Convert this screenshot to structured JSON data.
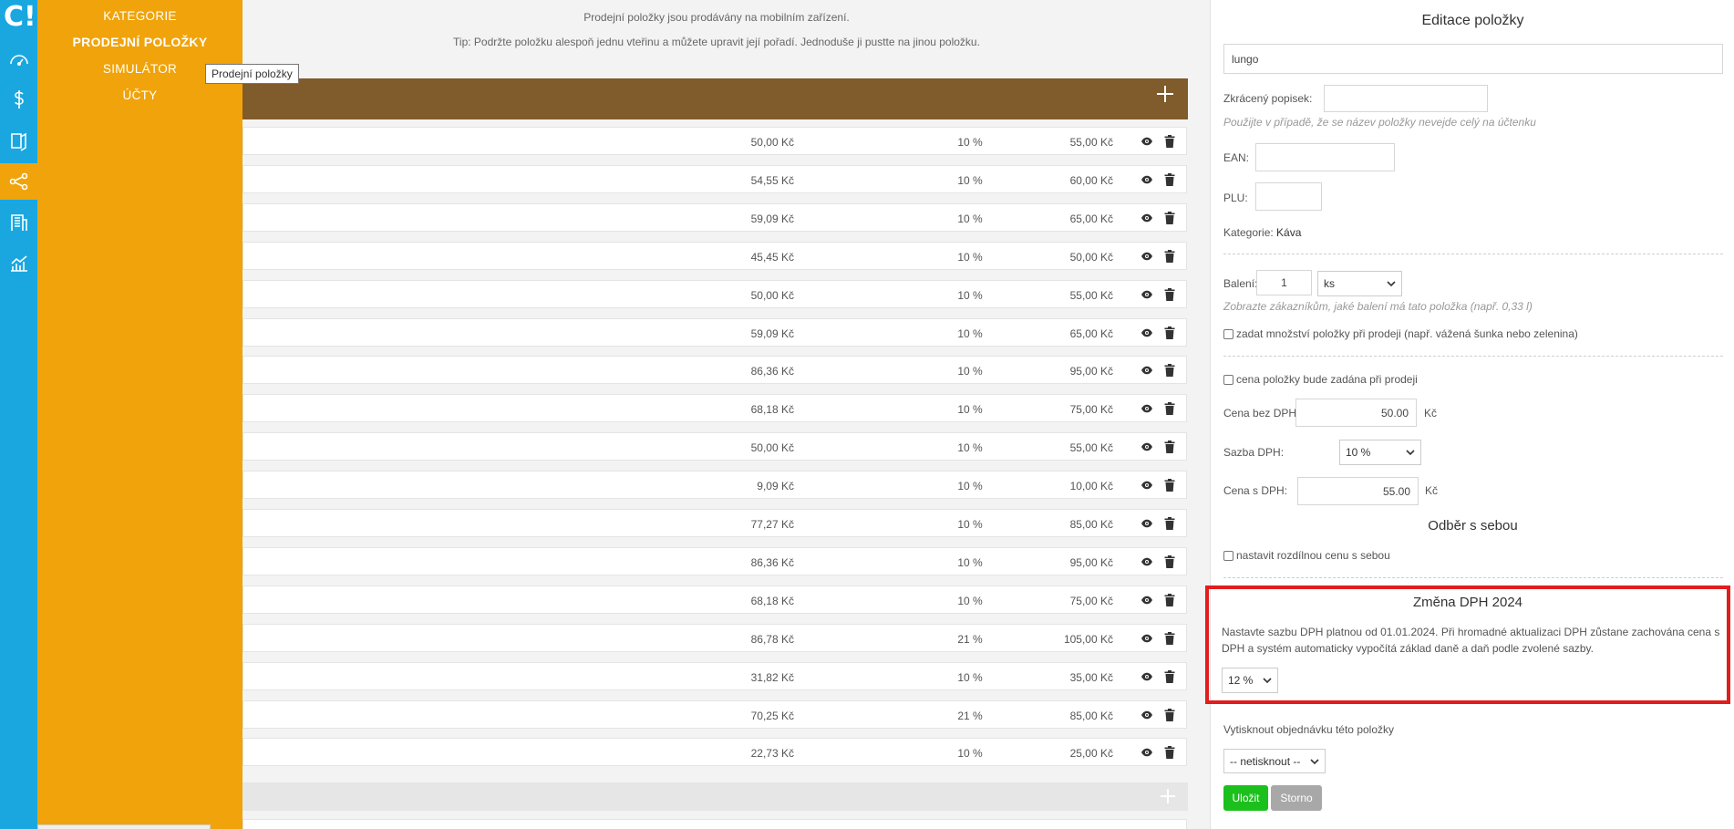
{
  "rail": {
    "logo": "C!",
    "icons": [
      "dashboard-icon",
      "dollar-icon",
      "documents-icon",
      "share-icon",
      "building-icon",
      "chart-icon"
    ]
  },
  "submenu": {
    "items": [
      "KATEGORIE",
      "PRODEJNÍ POLOŽKY",
      "SIMULÁTOR",
      "ÚČTY"
    ],
    "active_index": 1
  },
  "tooltip": "Prodejní položky",
  "info": {
    "line1": "Prodejní položky jsou prodávány na mobilním zařízení.",
    "line2": "Tip: Podržte položku alespoň jednu vteřinu a můžete upravit její pořadí. Jednoduše ji pustte na jinou položku."
  },
  "rows": [
    {
      "net": "50,00 Kč",
      "vat": "10 %",
      "gross": "55,00 Kč"
    },
    {
      "net": "54,55 Kč",
      "vat": "10 %",
      "gross": "60,00 Kč"
    },
    {
      "net": "59,09 Kč",
      "vat": "10 %",
      "gross": "65,00 Kč"
    },
    {
      "net": "45,45 Kč",
      "vat": "10 %",
      "gross": "50,00 Kč"
    },
    {
      "net": "50,00 Kč",
      "vat": "10 %",
      "gross": "55,00 Kč"
    },
    {
      "net": "59,09 Kč",
      "vat": "10 %",
      "gross": "65,00 Kč"
    },
    {
      "net": "86,36 Kč",
      "vat": "10 %",
      "gross": "95,00 Kč"
    },
    {
      "net": "68,18 Kč",
      "vat": "10 %",
      "gross": "75,00 Kč"
    },
    {
      "net": "50,00 Kč",
      "vat": "10 %",
      "gross": "55,00 Kč"
    },
    {
      "net": "9,09 Kč",
      "vat": "10 %",
      "gross": "10,00 Kč"
    },
    {
      "net": "77,27 Kč",
      "vat": "10 %",
      "gross": "85,00 Kč"
    },
    {
      "net": "86,36 Kč",
      "vat": "10 %",
      "gross": "95,00 Kč"
    },
    {
      "net": "68,18 Kč",
      "vat": "10 %",
      "gross": "75,00 Kč"
    },
    {
      "net": "86,78 Kč",
      "vat": "21 %",
      "gross": "105,00 Kč"
    },
    {
      "net": "31,82 Kč",
      "vat": "10 %",
      "gross": "35,00 Kč"
    },
    {
      "net": "70,25 Kč",
      "vat": "21 %",
      "gross": "85,00 Kč"
    },
    {
      "net": "22,73 Kč",
      "vat": "10 %",
      "gross": "25,00 Kč"
    }
  ],
  "panel": {
    "title": "Editace položky",
    "name_value": "lungo",
    "short_label": "Zkrácený popisek:",
    "short_value": "",
    "short_hint": "Použijte v případě, že se název položky nevejde celý na účtenku",
    "ean_label": "EAN:",
    "plu_label": "PLU:",
    "category_label": "Kategorie:",
    "category_value": "Káva",
    "pack_label": "Balení:",
    "pack_value": "1",
    "pack_unit": "ks",
    "pack_hint": "Zobrazte zákazníkům, jaké balení má tato položka (např. 0,33 l)",
    "qty_checkbox": "zadat množství položky při prodeji (např. vážená šunka nebo zelenina)",
    "price_checkbox": "cena položky bude zadána při prodeji",
    "net_label": "Cena bez DPH:",
    "net_value": "50.00",
    "currency": "Kč",
    "vat_label": "Sazba DPH:",
    "vat_value": "10 %",
    "gross_label": "Cena s DPH:",
    "gross_value": "55.00",
    "takeaway_title": "Odběr s sebou",
    "takeaway_checkbox": "nastavit rozdílnou cenu s sebou",
    "vat2024_title": "Změna DPH 2024",
    "vat2024_text": "Nastavte sazbu DPH platnou od 01.01.2024. Při hromadné aktualizaci DPH zůstane zachována cena s DPH a systém automaticky vypočítá základ daně a daň podle zvolené sazby.",
    "vat2024_value": "12 %",
    "print_label": "Vytisknout objednávku této položky",
    "print_value": "-- netisknout --",
    "save": "Uložit",
    "cancel": "Storno"
  },
  "colors": {
    "rail": "#1aa7e0",
    "submenu": "#f0a30a",
    "category_header": "#805b2c",
    "save": "#1cc01c",
    "cancel": "#a8a8a8",
    "highlight": "#e11d1d"
  }
}
